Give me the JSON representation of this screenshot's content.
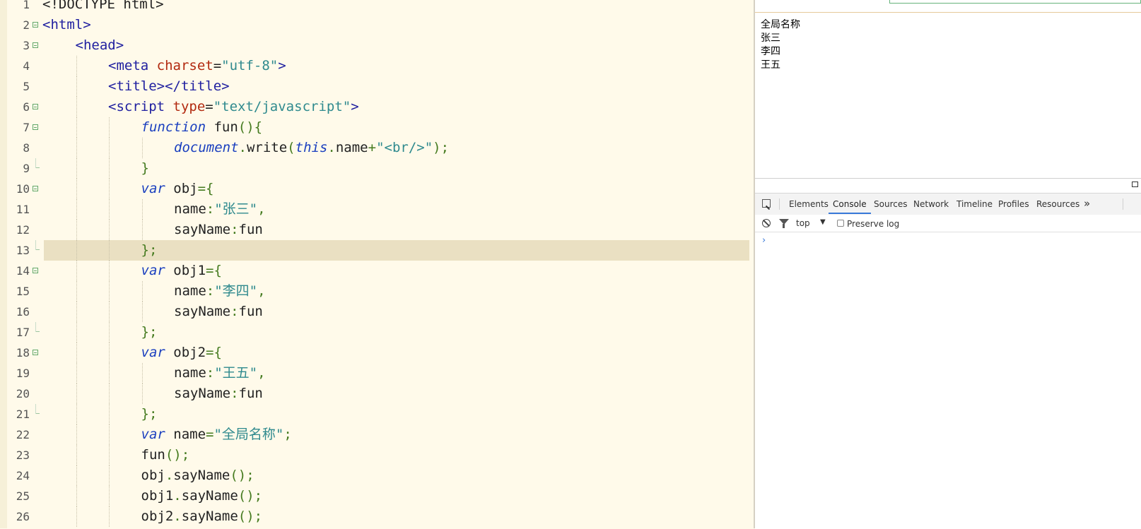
{
  "editor": {
    "active_line": 13,
    "lines": [
      {
        "n": 1,
        "indent": 0,
        "fold": "",
        "tokens": [
          {
            "t": "<!DOCTYPE html>",
            "c": "tk-t"
          }
        ]
      },
      {
        "n": 2,
        "indent": 0,
        "fold": "open",
        "tokens": [
          {
            "t": "<html>",
            "c": "tk-tag"
          }
        ]
      },
      {
        "n": 3,
        "indent": 1,
        "fold": "open",
        "tokens": [
          {
            "t": "<head>",
            "c": "tk-tag"
          }
        ]
      },
      {
        "n": 4,
        "indent": 2,
        "fold": "",
        "tokens": [
          {
            "t": "<meta ",
            "c": "tk-tag"
          },
          {
            "t": "charset",
            "c": "tk-attr"
          },
          {
            "t": "=",
            "c": "tk-t"
          },
          {
            "t": "\"utf-8\"",
            "c": "tk-str"
          },
          {
            "t": ">",
            "c": "tk-tag"
          }
        ]
      },
      {
        "n": 5,
        "indent": 2,
        "fold": "",
        "tokens": [
          {
            "t": "<title></title>",
            "c": "tk-tag"
          }
        ]
      },
      {
        "n": 6,
        "indent": 2,
        "fold": "open",
        "tokens": [
          {
            "t": "<script ",
            "c": "tk-tag"
          },
          {
            "t": "type",
            "c": "tk-attr"
          },
          {
            "t": "=",
            "c": "tk-t"
          },
          {
            "t": "\"text/javascript\"",
            "c": "tk-str"
          },
          {
            "t": ">",
            "c": "tk-tag"
          }
        ]
      },
      {
        "n": 7,
        "indent": 3,
        "fold": "open",
        "tokens": [
          {
            "t": "function",
            "c": "tk-kw"
          },
          {
            "t": " fun",
            "c": "tk-t"
          },
          {
            "t": "(){",
            "c": "tk-p"
          }
        ]
      },
      {
        "n": 8,
        "indent": 4,
        "fold": "",
        "tokens": [
          {
            "t": "document",
            "c": "tk-kw"
          },
          {
            "t": ".",
            "c": "tk-p"
          },
          {
            "t": "write",
            "c": "tk-t"
          },
          {
            "t": "(",
            "c": "tk-p"
          },
          {
            "t": "this",
            "c": "tk-kw"
          },
          {
            "t": ".",
            "c": "tk-p"
          },
          {
            "t": "name",
            "c": "tk-t"
          },
          {
            "t": "+",
            "c": "tk-p"
          },
          {
            "t": "\"<br/>\"",
            "c": "tk-str"
          },
          {
            "t": ");",
            "c": "tk-p"
          }
        ]
      },
      {
        "n": 9,
        "indent": 3,
        "fold": "end",
        "tokens": [
          {
            "t": "}",
            "c": "tk-p"
          }
        ]
      },
      {
        "n": 10,
        "indent": 3,
        "fold": "open",
        "tokens": [
          {
            "t": "var",
            "c": "tk-kw"
          },
          {
            "t": " obj",
            "c": "tk-t"
          },
          {
            "t": "={",
            "c": "tk-p"
          }
        ]
      },
      {
        "n": 11,
        "indent": 4,
        "fold": "",
        "tokens": [
          {
            "t": "name",
            "c": "tk-t"
          },
          {
            "t": ":",
            "c": "tk-p"
          },
          {
            "t": "\"张三\"",
            "c": "tk-str"
          },
          {
            "t": ",",
            "c": "tk-p"
          }
        ]
      },
      {
        "n": 12,
        "indent": 4,
        "fold": "",
        "tokens": [
          {
            "t": "sayName",
            "c": "tk-t"
          },
          {
            "t": ":",
            "c": "tk-p"
          },
          {
            "t": "fun",
            "c": "tk-t"
          }
        ]
      },
      {
        "n": 13,
        "indent": 3,
        "fold": "end",
        "tokens": [
          {
            "t": "};",
            "c": "tk-p"
          }
        ]
      },
      {
        "n": 14,
        "indent": 3,
        "fold": "open",
        "tokens": [
          {
            "t": "var",
            "c": "tk-kw"
          },
          {
            "t": " obj1",
            "c": "tk-t"
          },
          {
            "t": "={",
            "c": "tk-p"
          }
        ]
      },
      {
        "n": 15,
        "indent": 4,
        "fold": "",
        "tokens": [
          {
            "t": "name",
            "c": "tk-t"
          },
          {
            "t": ":",
            "c": "tk-p"
          },
          {
            "t": "\"李四\"",
            "c": "tk-str"
          },
          {
            "t": ",",
            "c": "tk-p"
          }
        ]
      },
      {
        "n": 16,
        "indent": 4,
        "fold": "",
        "tokens": [
          {
            "t": "sayName",
            "c": "tk-t"
          },
          {
            "t": ":",
            "c": "tk-p"
          },
          {
            "t": "fun",
            "c": "tk-t"
          }
        ]
      },
      {
        "n": 17,
        "indent": 3,
        "fold": "end",
        "tokens": [
          {
            "t": "};",
            "c": "tk-p"
          }
        ]
      },
      {
        "n": 18,
        "indent": 3,
        "fold": "open",
        "tokens": [
          {
            "t": "var",
            "c": "tk-kw"
          },
          {
            "t": " obj2",
            "c": "tk-t"
          },
          {
            "t": "={",
            "c": "tk-p"
          }
        ]
      },
      {
        "n": 19,
        "indent": 4,
        "fold": "",
        "tokens": [
          {
            "t": "name",
            "c": "tk-t"
          },
          {
            "t": ":",
            "c": "tk-p"
          },
          {
            "t": "\"王五\"",
            "c": "tk-str"
          },
          {
            "t": ",",
            "c": "tk-p"
          }
        ]
      },
      {
        "n": 20,
        "indent": 4,
        "fold": "",
        "tokens": [
          {
            "t": "sayName",
            "c": "tk-t"
          },
          {
            "t": ":",
            "c": "tk-p"
          },
          {
            "t": "fun",
            "c": "tk-t"
          }
        ]
      },
      {
        "n": 21,
        "indent": 3,
        "fold": "end",
        "tokens": [
          {
            "t": "};",
            "c": "tk-p"
          }
        ]
      },
      {
        "n": 22,
        "indent": 3,
        "fold": "",
        "tokens": [
          {
            "t": "var",
            "c": "tk-kw"
          },
          {
            "t": " name",
            "c": "tk-t"
          },
          {
            "t": "=",
            "c": "tk-p"
          },
          {
            "t": "\"全局名称\"",
            "c": "tk-str"
          },
          {
            "t": ";",
            "c": "tk-p"
          }
        ]
      },
      {
        "n": 23,
        "indent": 3,
        "fold": "",
        "tokens": [
          {
            "t": "fun",
            "c": "tk-t"
          },
          {
            "t": "();",
            "c": "tk-p"
          }
        ]
      },
      {
        "n": 24,
        "indent": 3,
        "fold": "",
        "tokens": [
          {
            "t": "obj",
            "c": "tk-t"
          },
          {
            "t": ".",
            "c": "tk-p"
          },
          {
            "t": "sayName",
            "c": "tk-t"
          },
          {
            "t": "();",
            "c": "tk-p"
          }
        ]
      },
      {
        "n": 25,
        "indent": 3,
        "fold": "",
        "tokens": [
          {
            "t": "obj1",
            "c": "tk-t"
          },
          {
            "t": ".",
            "c": "tk-p"
          },
          {
            "t": "sayName",
            "c": "tk-t"
          },
          {
            "t": "();",
            "c": "tk-p"
          }
        ]
      },
      {
        "n": 26,
        "indent": 3,
        "fold": "",
        "tokens": [
          {
            "t": "obj2",
            "c": "tk-t"
          },
          {
            "t": ".",
            "c": "tk-p"
          },
          {
            "t": "sayName",
            "c": "tk-t"
          },
          {
            "t": "();",
            "c": "tk-p"
          }
        ]
      }
    ]
  },
  "preview": {
    "output_lines": [
      "全局名称",
      "张三",
      "李四",
      "王五"
    ]
  },
  "devtools": {
    "tabs": [
      "Elements",
      "Console",
      "Sources",
      "Network",
      "Timeline",
      "Profiles",
      "Resources"
    ],
    "active_tab": "Console",
    "more_tabs_glyph": "»",
    "context": "top",
    "context_arrow": "▼",
    "preserve_log_label": "Preserve log",
    "prompt_glyph": "›"
  },
  "icons": {
    "editor_fold": "fold-toggle-icon",
    "inspect": "inspect-element-icon",
    "clear": "clear-console-icon",
    "filter": "filter-icon",
    "undock": "undock-icon"
  },
  "colors": {
    "editor_bg": "#fffaea",
    "active_line_bg": "#eae0c2",
    "tag": "#2020a0",
    "attr": "#b22a10",
    "string": "#2f8a8e",
    "keyword": "#1a3fbf",
    "punct": "#447a1e",
    "tab_underline": "#3879d9"
  }
}
